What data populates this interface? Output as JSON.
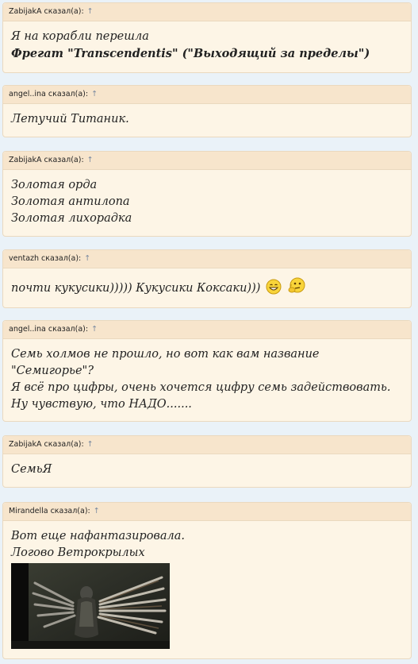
{
  "posts": [
    {
      "author": "ZabijakA сказал(а):",
      "arrow": "↑",
      "lines": [
        "Я на корабли перешла",
        "Фрегат \"Transcendentis\" (\"Выходящий за пределы\")"
      ]
    },
    {
      "author": "angel..ina сказал(а):",
      "arrow": "↑",
      "lines": [
        "Летучий Титаник."
      ]
    },
    {
      "author": "ZabijakA сказал(а):",
      "arrow": "↑",
      "lines": [
        "Золотая орда",
        "Золотая антилопа",
        "Золотая лихорадка"
      ]
    },
    {
      "author": "ventazh сказал(а):",
      "arrow": "↑",
      "lines": [
        "почти кукусики))))) Кукусики Коксаки)))"
      ],
      "smileys": [
        "grin-smiley-icon",
        "thinking-smiley-icon"
      ]
    },
    {
      "author": "angel..ina сказал(а):",
      "arrow": "↑",
      "lines": [
        "Семь холмов не прошло, но вот как вам название \"Семигорье\"?",
        "Я всё про цифры, очень хочется цифру семь задействовать. Ну чувствую, что НАДО......."
      ]
    },
    {
      "author": "ZabijakA сказал(а):",
      "arrow": "↑",
      "lines": [
        "СемьЯ"
      ]
    },
    {
      "author": "Mirandella сказал(а):",
      "arrow": "↑",
      "lines": [
        "Вот еще нафантазировала.",
        "Логово Ветрокрылых"
      ],
      "image": "winged-figure-image"
    }
  ]
}
